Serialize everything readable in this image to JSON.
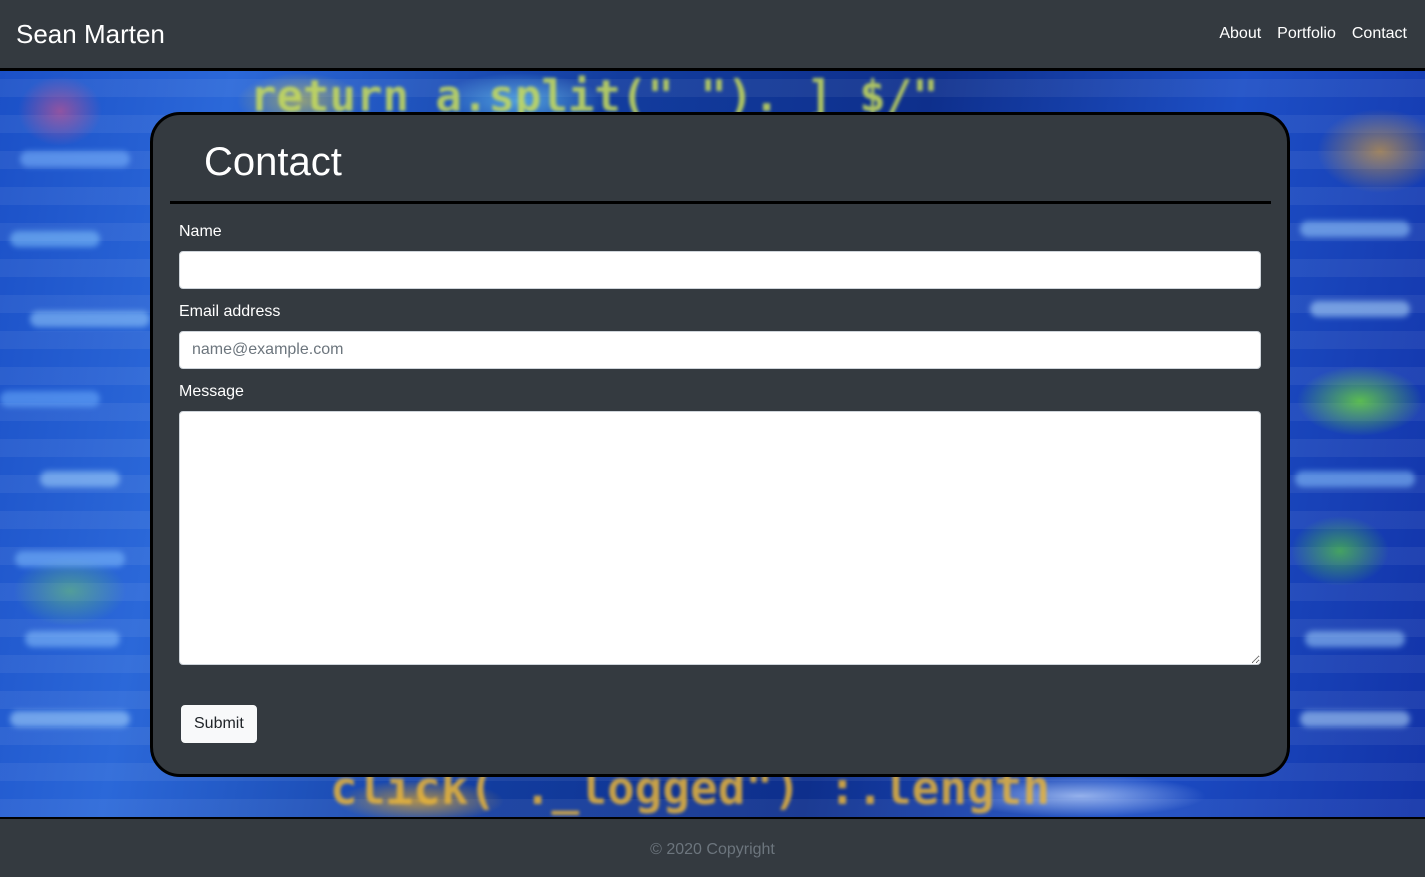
{
  "navbar": {
    "brand": "Sean Marten",
    "links": [
      {
        "label": "About"
      },
      {
        "label": "Portfolio"
      },
      {
        "label": "Contact"
      }
    ]
  },
  "hero": {
    "background_text_top": "return a.split(\" \"). ] $/\"",
    "background_text_bottom": "click( ._logged\")  :.length"
  },
  "contact_form": {
    "title": "Contact",
    "name_label": "Name",
    "name_value": "",
    "email_label": "Email address",
    "email_placeholder": "name@example.com",
    "email_value": "",
    "message_label": "Message",
    "message_value": "",
    "submit_label": "Submit"
  },
  "footer": {
    "copyright": "© 2020 Copyright"
  },
  "colors": {
    "dark_bg": "#343a40",
    "border": "#000000",
    "text": "#ffffff",
    "muted": "#6c757d",
    "button_bg": "#f8f9fa"
  }
}
